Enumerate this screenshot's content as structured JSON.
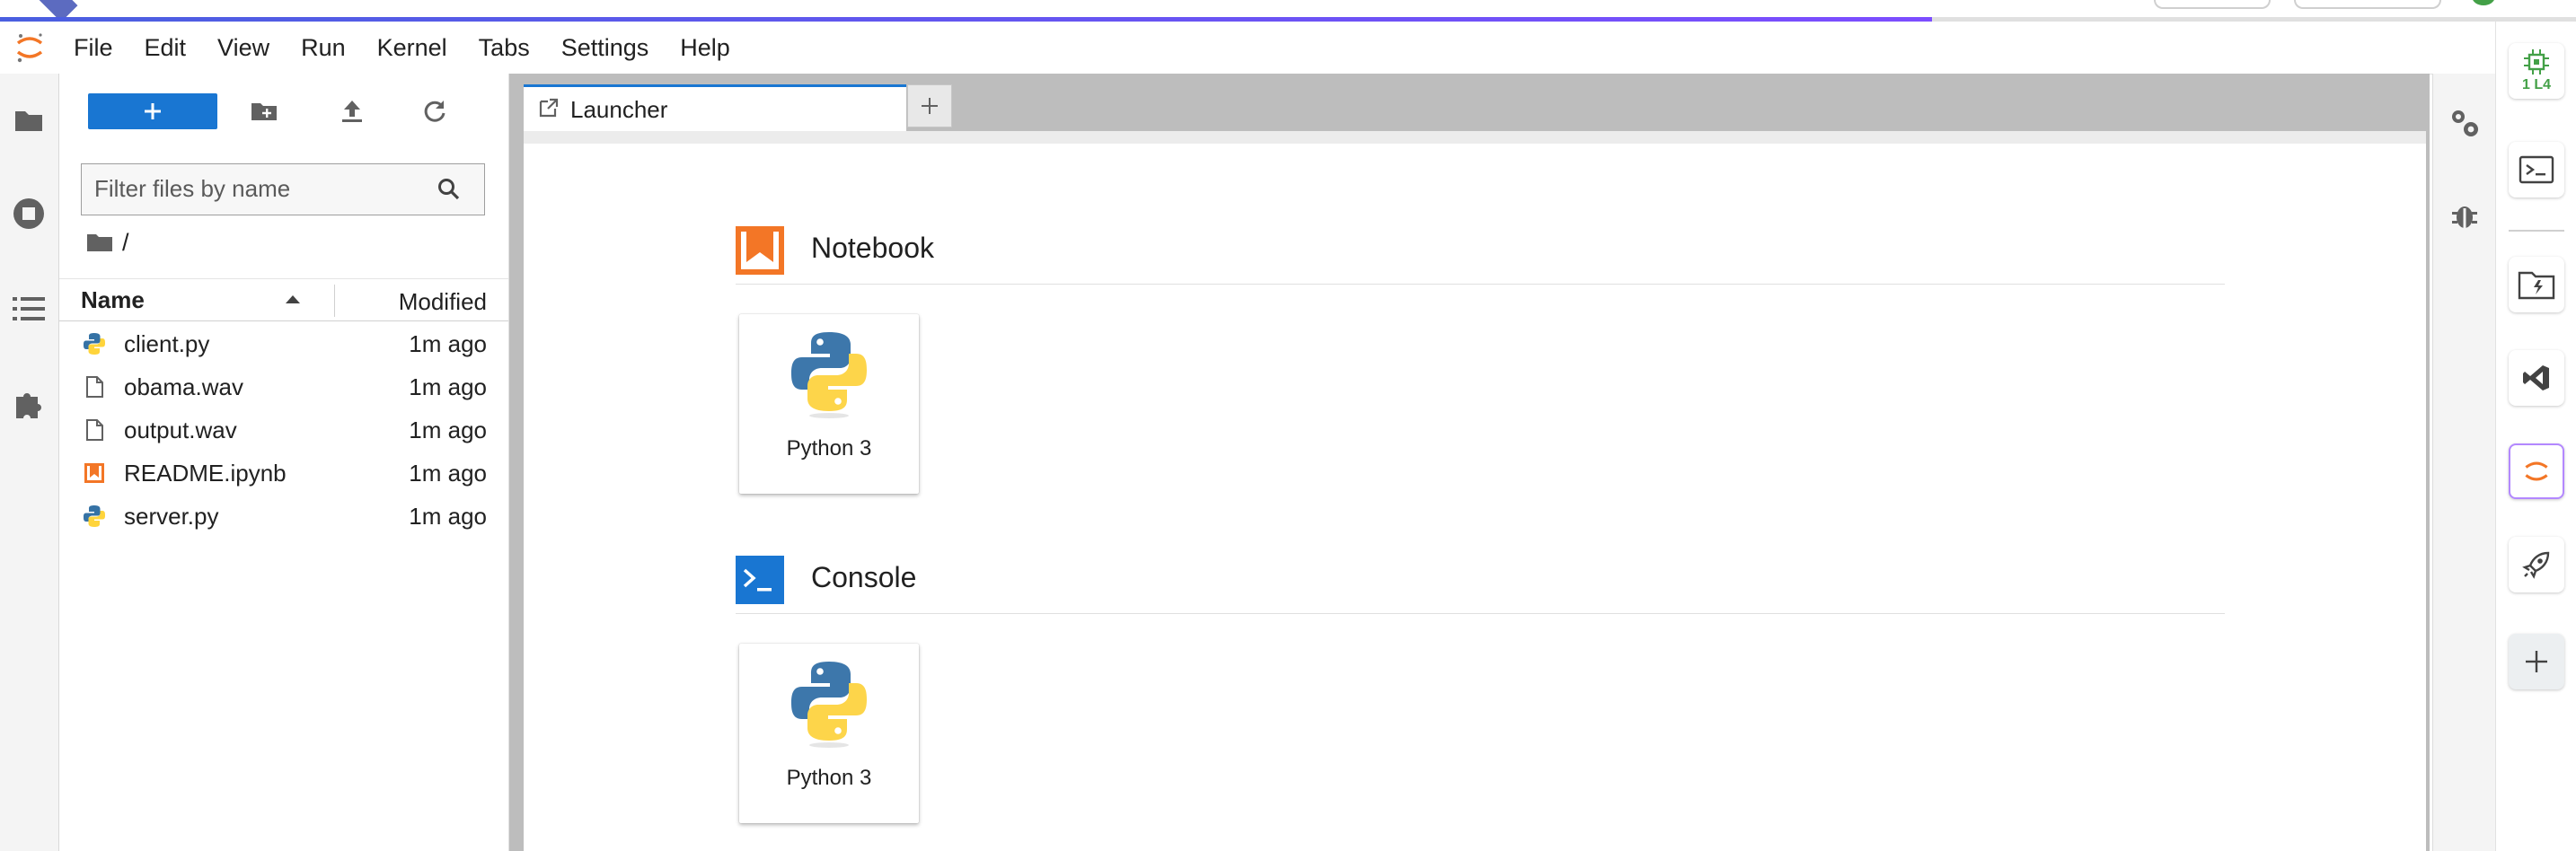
{
  "menubar": {
    "items": [
      "File",
      "Edit",
      "View",
      "Run",
      "Kernel",
      "Tabs",
      "Settings",
      "Help"
    ]
  },
  "loading": {
    "progress": 0.75
  },
  "file_browser": {
    "filter_placeholder": "Filter files by name",
    "breadcrumb": "/",
    "columns": {
      "name": "Name",
      "modified": "Modified"
    },
    "files": [
      {
        "name": "client.py",
        "modified": "1m ago",
        "icon": "python-file-icon"
      },
      {
        "name": "obama.wav",
        "modified": "1m ago",
        "icon": "file-icon"
      },
      {
        "name": "output.wav",
        "modified": "1m ago",
        "icon": "file-icon"
      },
      {
        "name": "README.ipynb",
        "modified": "1m ago",
        "icon": "notebook-file-icon"
      },
      {
        "name": "server.py",
        "modified": "1m ago",
        "icon": "python-file-icon"
      }
    ]
  },
  "tabs": {
    "launcher_label": "Launcher"
  },
  "launcher": {
    "sections": [
      {
        "title": "Notebook",
        "icon": "notebook-section-icon",
        "cards": [
          {
            "label": "Python 3"
          }
        ]
      },
      {
        "title": "Console",
        "icon": "console-section-icon",
        "cards": [
          {
            "label": "Python 3"
          }
        ]
      }
    ]
  },
  "ext_sidebar": {
    "gpu_label": "1 L4"
  },
  "colors": {
    "accent": "#1976d2",
    "notebook_orange": "#f37626",
    "console_blue": "#1976d2",
    "gpu_green": "#43a047"
  }
}
